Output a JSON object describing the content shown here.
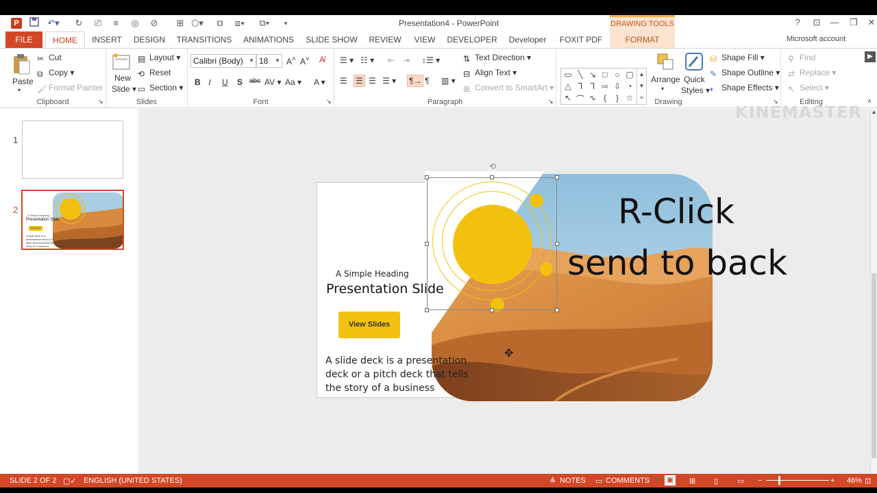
{
  "title_bar": {
    "document_title": "Presentation4 - PowerPoint",
    "contextual_tab_group": "DRAWING TOOLS",
    "app_logo": "P",
    "help": "?",
    "account": "Microsoft account"
  },
  "tabs": [
    "FILE",
    "HOME",
    "INSERT",
    "DESIGN",
    "TRANSITIONS",
    "ANIMATIONS",
    "SLIDE SHOW",
    "REVIEW",
    "VIEW",
    "DEVELOPER",
    "Developer",
    "FOXIT PDF",
    "FORMAT"
  ],
  "ribbon": {
    "clipboard": {
      "label": "Clipboard",
      "paste": "Paste",
      "cut": "Cut",
      "copy": "Copy",
      "format_painter": "Format Painter"
    },
    "slides": {
      "label": "Slides",
      "new_slide_1": "New",
      "new_slide_2": "Slide",
      "layout": "Layout",
      "reset": "Reset",
      "section": "Section"
    },
    "font": {
      "label": "Font",
      "font_name": "Calibri (Body)",
      "font_size": "18"
    },
    "paragraph": {
      "label": "Paragraph",
      "text_direction": "Text Direction",
      "align_text": "Align Text",
      "convert_smartart": "Convert to SmartArt"
    },
    "drawing": {
      "label": "Drawing",
      "arrange": "Arrange",
      "quick_styles_1": "Quick",
      "quick_styles_2": "Styles",
      "shape_fill": "Shape Fill",
      "shape_outline": "Shape Outline",
      "shape_effects": "Shape Effects"
    },
    "editing": {
      "label": "Editing",
      "find": "Find",
      "replace": "Replace",
      "select": "Select"
    }
  },
  "thumbnails": [
    {
      "number": "1"
    },
    {
      "number": "2",
      "heading": "A Simple Heading",
      "title": "Presentation Slide",
      "button": "View Slides",
      "body": "A slide deck is a presentation deck or a pitch deck that tells the story of a business"
    }
  ],
  "slide": {
    "heading": "A Simple Heading",
    "title": "Presentation Slide",
    "button_label": "View Slides",
    "body_line_1": "A slide deck is a presentation",
    "body_line_2": "deck or a pitch deck that tells",
    "body_line_3": "the story of a business"
  },
  "overlay": {
    "annotation_line_1": "R-Click",
    "annotation_line_2": "send to back",
    "watermark": "KINEMASTER"
  },
  "status_bar": {
    "slide_position": "SLIDE 2 OF 2",
    "language": "ENGLISH (UNITED STATES)",
    "notes": "NOTES",
    "comments": "COMMENTS",
    "zoom": "46%"
  },
  "colors": {
    "accent": "#d24726",
    "sun_yellow": "#f2c10f",
    "sky": "#9fc8df",
    "sand": "#d98a3d"
  }
}
